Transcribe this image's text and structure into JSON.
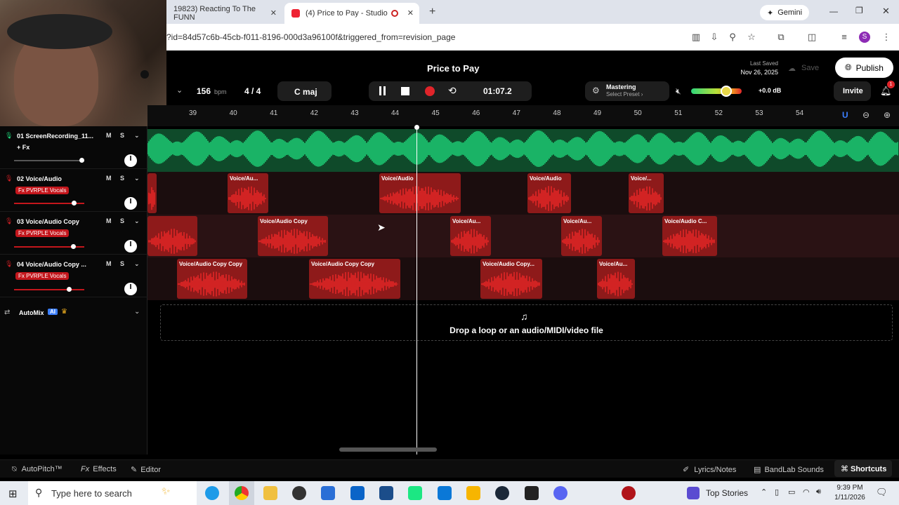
{
  "browser": {
    "tabs": [
      {
        "title": "19823) Reacting To The FUNN",
        "active": false
      },
      {
        "title": "(4) Price to Pay - Studio",
        "active": true
      }
    ],
    "gemini_label": "Gemini",
    "url": "?id=84d57c6b-45cb-f011-8196-000d3a96100f&triggered_from=revision_page",
    "profile_initial": "S"
  },
  "studio": {
    "title": "Price to Pay",
    "last_saved_label": "Last Saved",
    "last_saved_date": "Nov 26, 2025",
    "save_label": "Save",
    "publish_label": "Publish",
    "invite_label": "Invite",
    "notification_count": "1",
    "bpm_value": "156",
    "bpm_unit": "bpm",
    "time_signature": "4 / 4",
    "key": "C maj",
    "time_display": "01:07.2",
    "mastering_label": "Mastering",
    "mastering_preset": "Select Preset ›",
    "volume_db": "+0.0 dB",
    "volume_level": 0.7
  },
  "ruler": {
    "bars": [
      "39",
      "40",
      "41",
      "42",
      "43",
      "44",
      "45",
      "46",
      "47",
      "48",
      "49",
      "50",
      "51",
      "52",
      "53",
      "54"
    ]
  },
  "tracks": [
    {
      "name": "01  ScreenRecording_11...",
      "fx": "+ Fx",
      "fx_badge": false,
      "color": "#1fd67a"
    },
    {
      "name": "02  Voice/Audio",
      "fx": "Fx PVRPLE Vocals",
      "fx_badge": true,
      "color": "#d01f24"
    },
    {
      "name": "03  Voice/Audio Copy",
      "fx": "Fx PVRPLE Vocals",
      "fx_badge": true,
      "color": "#d01f24"
    },
    {
      "name": "04  Voice/Audio Copy ...",
      "fx": "Fx PVRPLE Vocals",
      "fx_badge": true,
      "color": "#d01f24"
    }
  ],
  "track_buttons": {
    "mute": "M",
    "solo": "S"
  },
  "clips": {
    "lane2": [
      "Voice/Au...",
      "Voice/Audio",
      "Voice/Audio",
      "Voice/..."
    ],
    "lane3": [
      "Voice/Audio Copy",
      "Voice/Au...",
      "Voice/Au...",
      "Voice/Audio C..."
    ],
    "lane4": [
      "Voice/Audio Copy Copy",
      "Voice/Audio Copy Copy",
      "Voice/Audio Copy...",
      "Voice/Au..."
    ]
  },
  "automix": {
    "label": "AutoMix",
    "badge": "AI"
  },
  "drop_zone": "Drop a loop or an audio/MIDI/video file",
  "bottom_bar": {
    "autopitch": "AutoPitch™",
    "effects": "Effects",
    "editor": "Editor",
    "lyrics": "Lyrics/Notes",
    "sounds": "BandLab Sounds",
    "shortcuts": "Shortcuts"
  },
  "taskbar": {
    "search_placeholder": "Type here to search",
    "news": "Top Stories",
    "time": "9:39 PM",
    "date": "1/11/2026"
  },
  "colors": {
    "accent_green": "#1fd67a",
    "accent_red": "#d01f24",
    "record": "#e0242a"
  }
}
